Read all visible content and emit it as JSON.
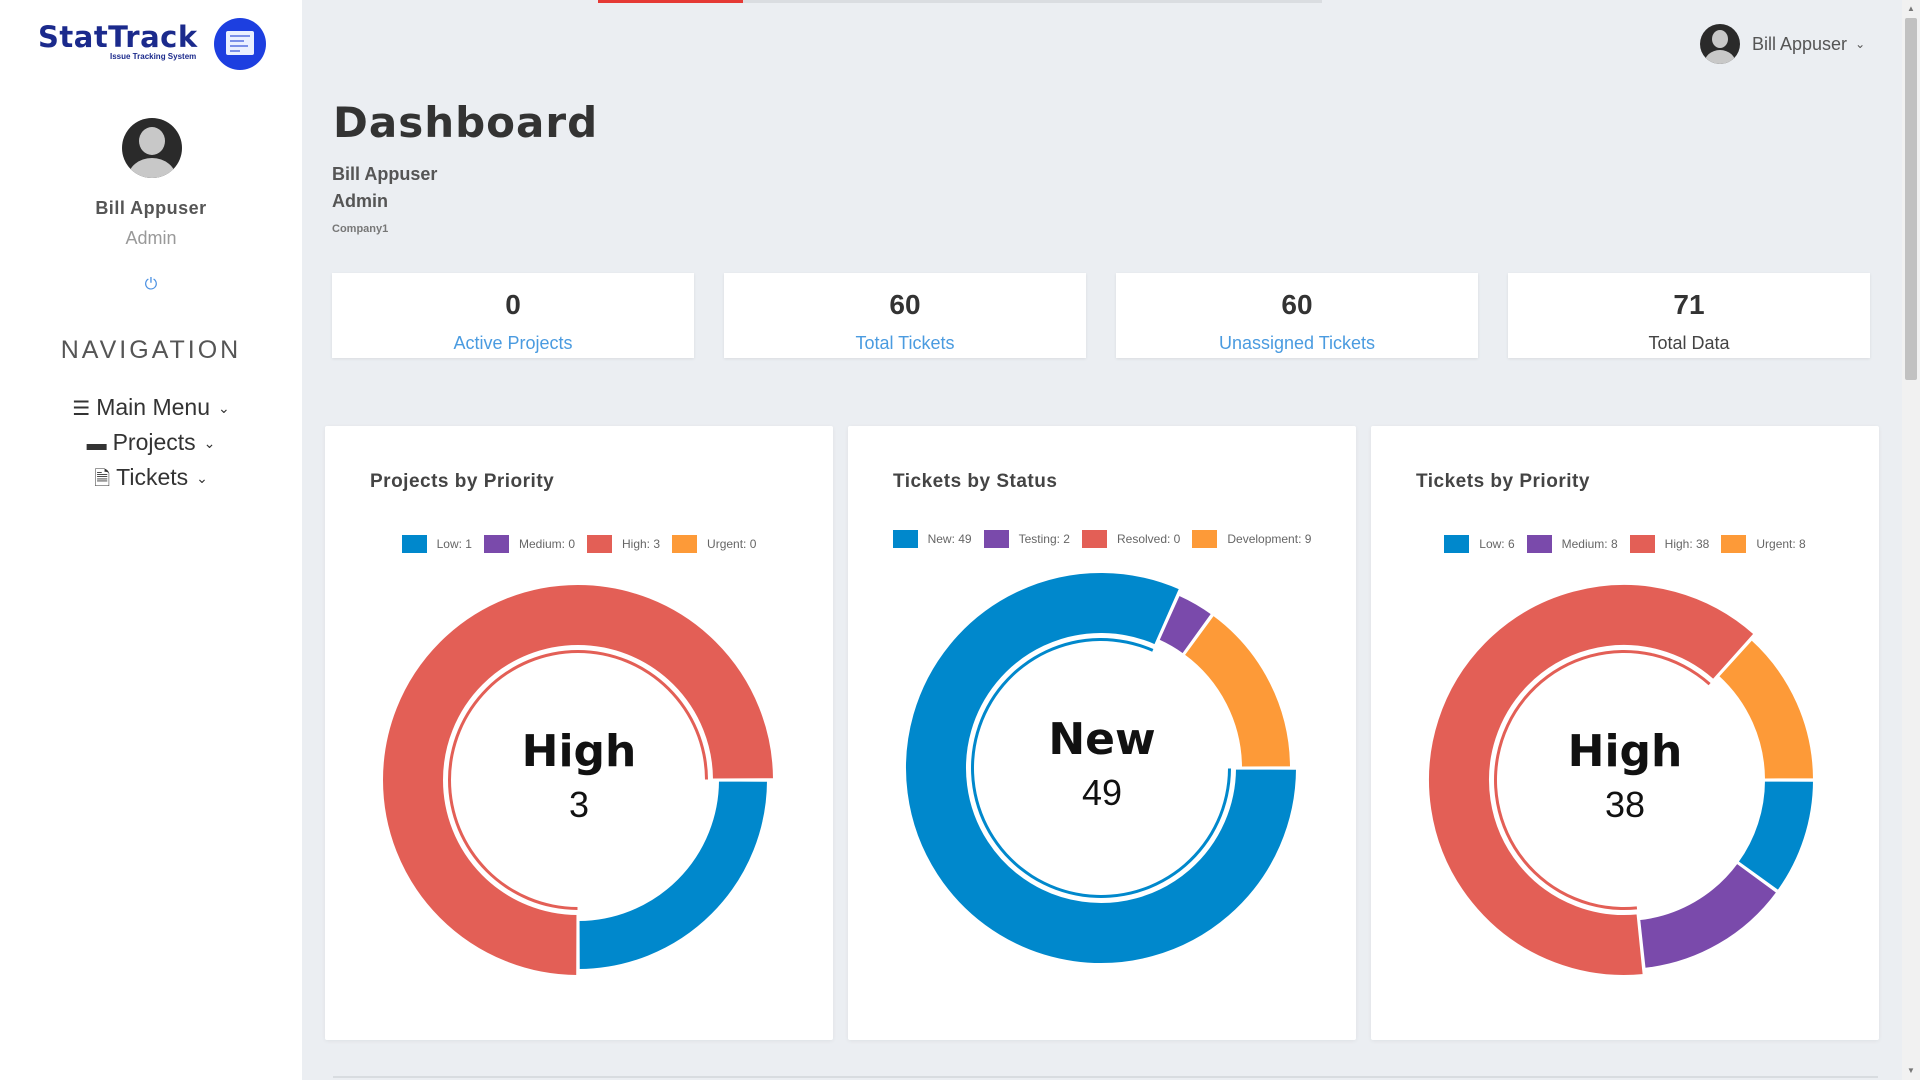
{
  "app": {
    "logo_text": "StatTrack",
    "logo_tagline": "Issue Tracking System",
    "brand_color": "#1d3fe0"
  },
  "sidebar": {
    "user_name": "Bill Appuser",
    "user_role": "Admin",
    "power_icon": "⏻",
    "nav_title": "NAVIGATION",
    "items": [
      {
        "label": "Main Menu",
        "icon": "☰",
        "icon_name": "menu-icon"
      },
      {
        "label": "Projects",
        "icon": "▬",
        "icon_name": "folder-icon"
      },
      {
        "label": "Tickets",
        "icon": "🗎",
        "icon_name": "file-icon"
      }
    ]
  },
  "topbar": {
    "user_name": "Bill Appuser",
    "accent": "#e53935"
  },
  "header": {
    "title": "Dashboard",
    "user_name": "Bill Appuser",
    "user_role": "Admin",
    "company": "Company1"
  },
  "stats": [
    {
      "value": "0",
      "label": "Active Projects",
      "link": true
    },
    {
      "value": "60",
      "label": "Total Tickets",
      "link": true
    },
    {
      "value": "60",
      "label": "Unassigned Tickets",
      "link": true
    },
    {
      "value": "71",
      "label": "Total Data",
      "link": false
    }
  ],
  "chart_data": [
    {
      "type": "pie",
      "title": "Projects by Priority",
      "categories": [
        "Low",
        "Medium",
        "High",
        "Urgent"
      ],
      "values": [
        1,
        0,
        3,
        0
      ],
      "legend_labels": [
        "Low: 1",
        "Medium: 0",
        "High: 3",
        "Urgent: 0"
      ],
      "colors": [
        "#0088cc",
        "#7a4aab",
        "#e35f56",
        "#fd9a38"
      ],
      "center_label": "High",
      "center_value": "3",
      "highlight": "High"
    },
    {
      "type": "pie",
      "title": "Tickets by Status",
      "categories": [
        "New",
        "Testing",
        "Resolved",
        "Development"
      ],
      "values": [
        49,
        2,
        0,
        9
      ],
      "legend_labels": [
        "New: 49",
        "Testing: 2",
        "Resolved: 0",
        "Development: 9"
      ],
      "colors": [
        "#0088cc",
        "#7a4aab",
        "#e35f56",
        "#fd9a38"
      ],
      "center_label": "New",
      "center_value": "49",
      "highlight": "New"
    },
    {
      "type": "pie",
      "title": "Tickets by Priority",
      "categories": [
        "Low",
        "Medium",
        "High",
        "Urgent"
      ],
      "values": [
        6,
        8,
        38,
        8
      ],
      "legend_labels": [
        "Low: 6",
        "Medium: 8",
        "High: 38",
        "Urgent: 8"
      ],
      "colors": [
        "#0088cc",
        "#7a4aab",
        "#e35f56",
        "#fd9a38"
      ],
      "center_label": "High",
      "center_value": "38",
      "highlight": "High"
    }
  ]
}
